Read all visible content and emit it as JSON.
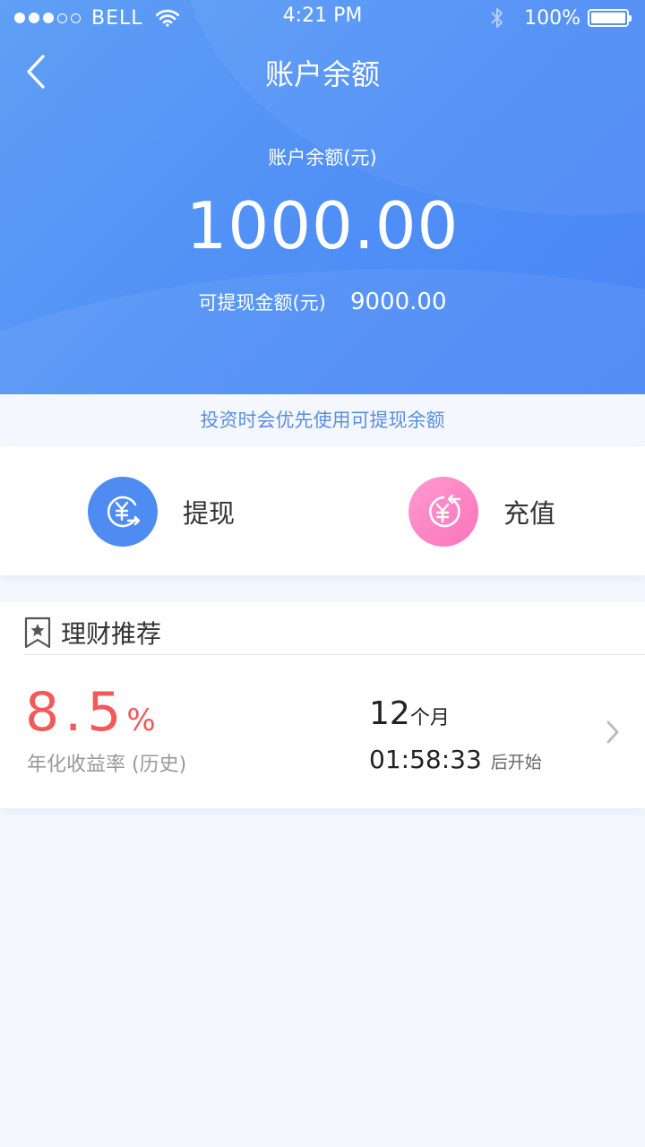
{
  "status_bar": {
    "carrier": "BELL",
    "time": "4:21 PM",
    "battery": "100%"
  },
  "nav": {
    "title": "账户余额"
  },
  "balance": {
    "label": "账户余额(元)",
    "amount": "1000.00",
    "withdrawable_label": "可提现金额(元)",
    "withdrawable_value": "9000.00"
  },
  "notice": "投资时会优先使用可提现余额",
  "actions": {
    "withdraw": "提现",
    "recharge": "充值"
  },
  "recommend": {
    "title": "理财推荐",
    "item": {
      "rate": "8.5",
      "rate_unit": "%",
      "rate_label": "年化收益率 (历史)",
      "term": "12",
      "term_unit": "个月",
      "countdown": "01:58:33",
      "countdown_suffix": "后开始"
    }
  },
  "colors": {
    "header_blue": "#5094f6",
    "rate_red": "#f25a5a",
    "notice_blue": "#5a8ee0",
    "recharge_pink": "#fb73bb"
  }
}
